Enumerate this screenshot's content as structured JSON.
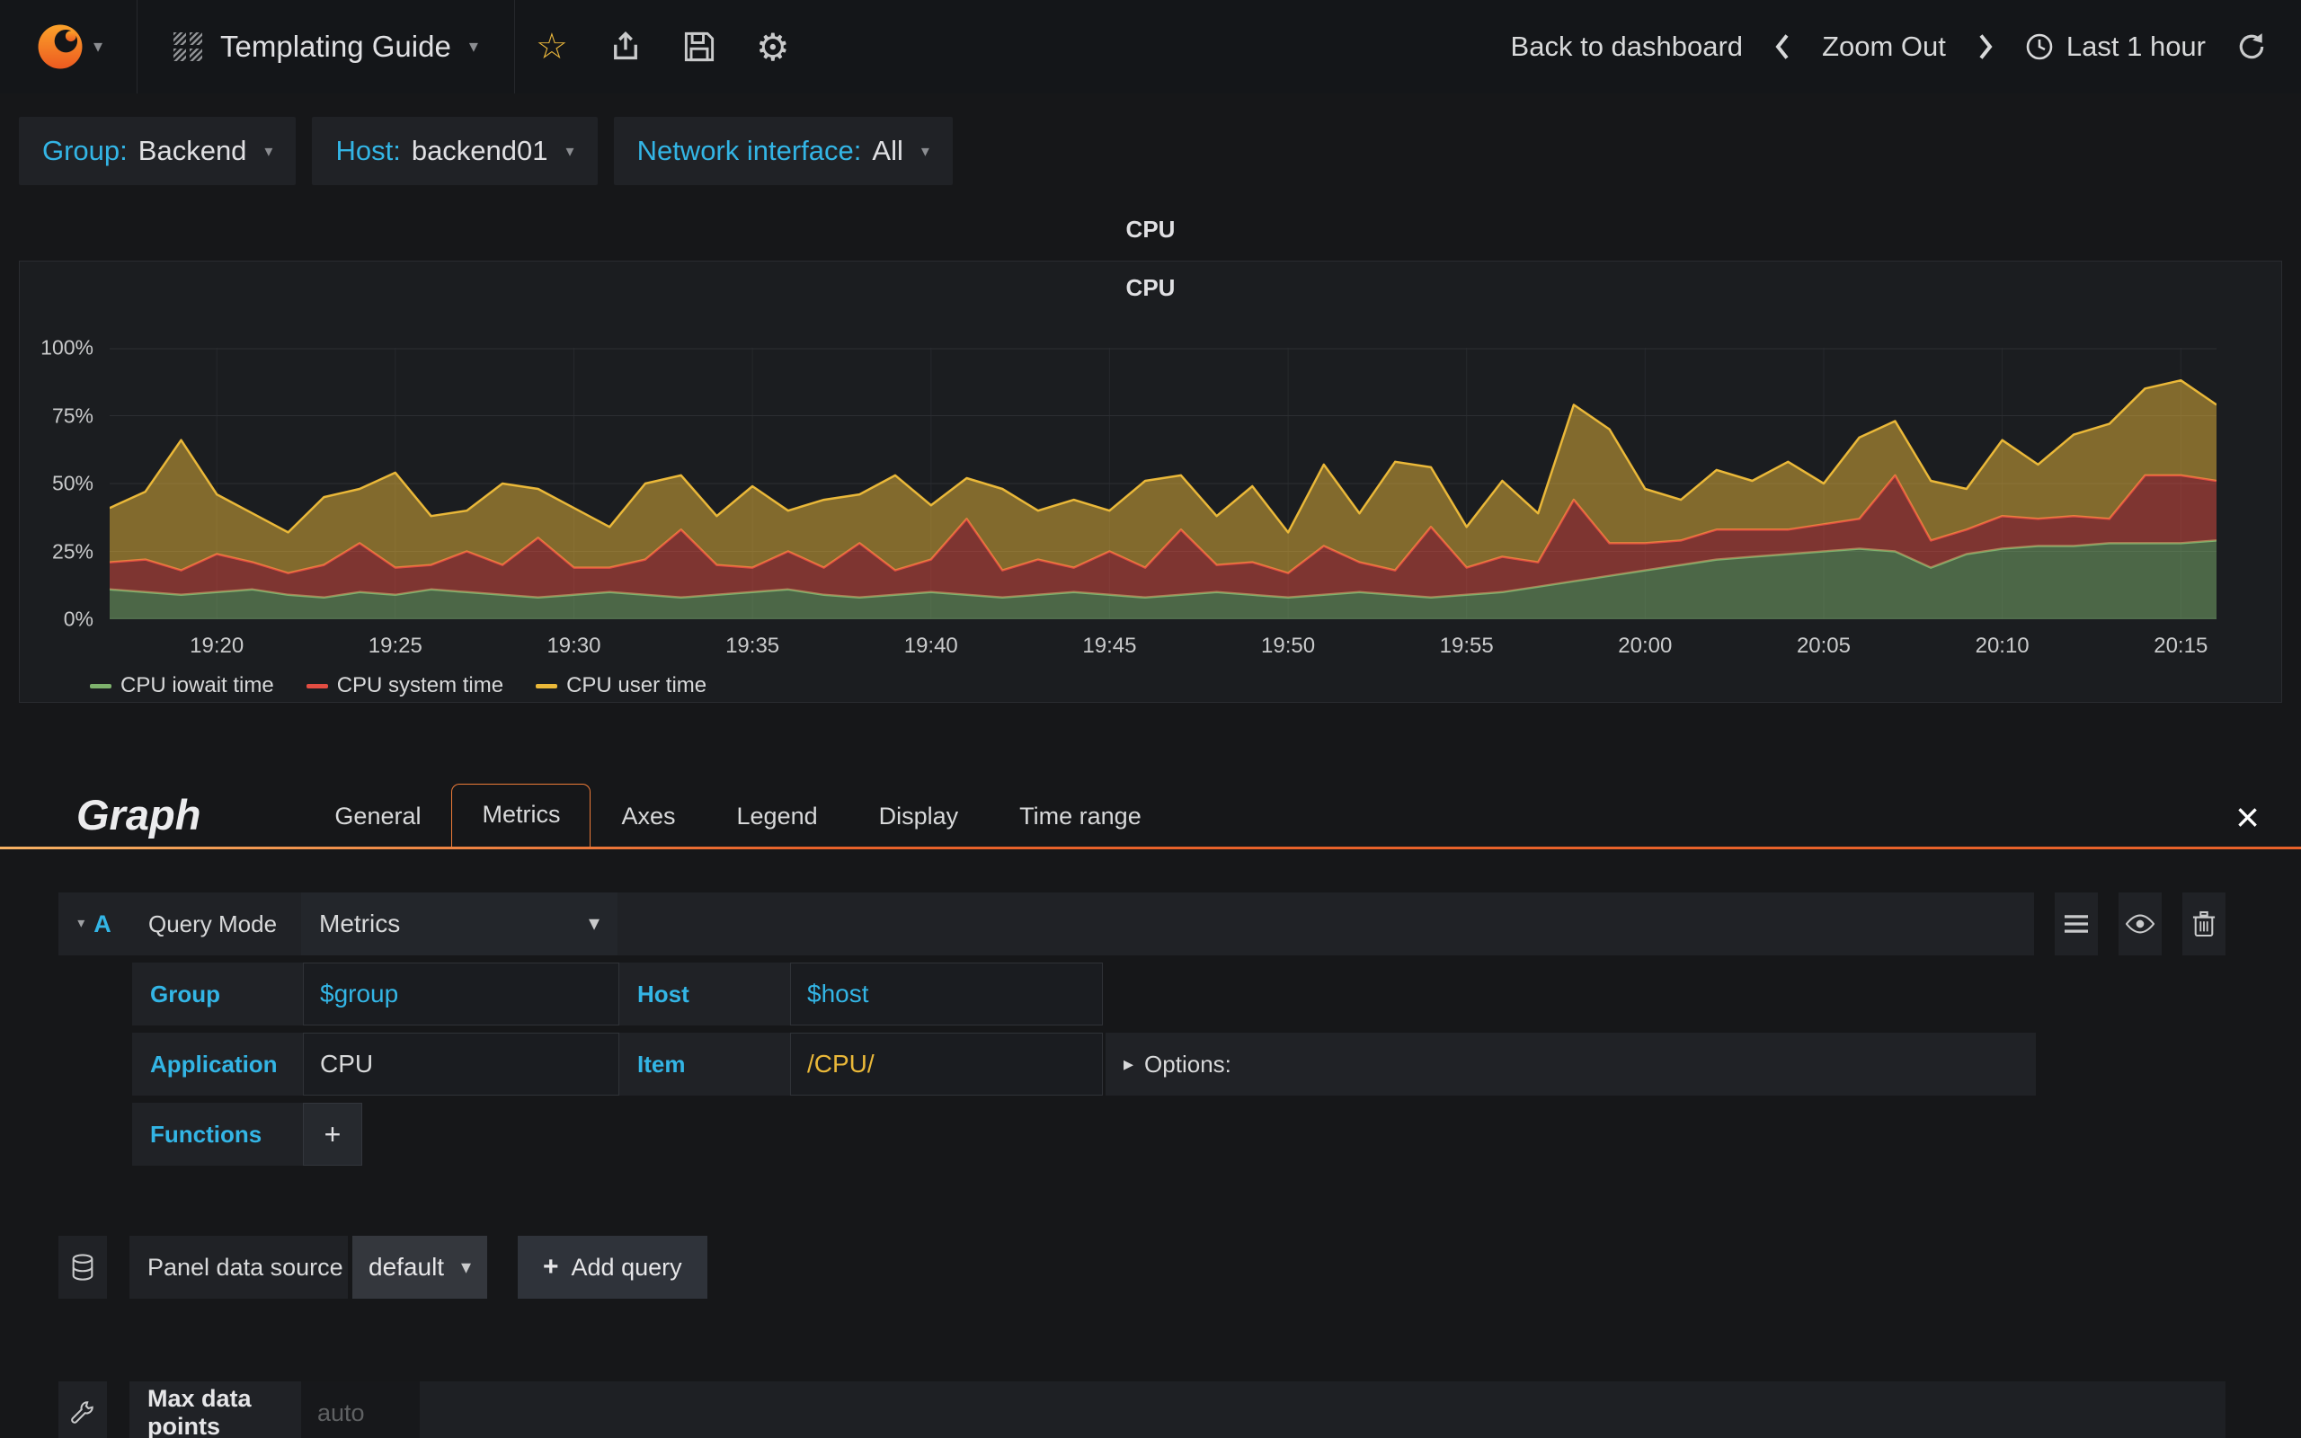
{
  "glyphs": {
    "caret_down": "▾",
    "caret_right": "▸",
    "star": "☆",
    "gear": "⚙",
    "plus": "+",
    "close": "×"
  },
  "colors": {
    "accent_cyan": "#33b5e5",
    "tab_orange": "#ec7b38",
    "green": "#7EB26D",
    "red": "#E24D42",
    "yellow": "#EAB839"
  },
  "navbar": {
    "title": "Templating Guide",
    "back_to_dashboard": "Back to dashboard",
    "zoom_out": "Zoom Out",
    "time_range": "Last 1 hour"
  },
  "template_vars": [
    {
      "label": "Group:",
      "value": "Backend"
    },
    {
      "label": "Host:",
      "value": "backend01"
    },
    {
      "label": "Network interface:",
      "value": "All"
    }
  ],
  "panel": {
    "outer_title": "CPU",
    "title": "CPU"
  },
  "chart_data": {
    "type": "area",
    "stacked": true,
    "title": "CPU",
    "ylim": [
      0,
      100
    ],
    "grid": true,
    "legend_position": "bottom",
    "y_ticks": [
      "0%",
      "25%",
      "50%",
      "75%",
      "100%"
    ],
    "x_ticks": [
      "19:20",
      "19:25",
      "19:30",
      "19:35",
      "19:40",
      "19:45",
      "19:50",
      "19:55",
      "20:00",
      "20:05",
      "20:10",
      "20:15"
    ],
    "tick_start_index": 3,
    "tick_step": 5,
    "x_start": "19:17",
    "x_interval_minutes": 1,
    "series": [
      {
        "name": "CPU iowait time",
        "color": "#7EB26D",
        "values": [
          11,
          10,
          9,
          10,
          11,
          9,
          8,
          10,
          9,
          11,
          10,
          9,
          8,
          9,
          10,
          9,
          8,
          9,
          10,
          11,
          9,
          8,
          9,
          10,
          9,
          8,
          9,
          10,
          9,
          8,
          9,
          10,
          9,
          8,
          9,
          10,
          9,
          8,
          9,
          10,
          12,
          14,
          16,
          18,
          20,
          22,
          23,
          24,
          25,
          26,
          25,
          19,
          24,
          26,
          27,
          27,
          28,
          28,
          28,
          29
        ]
      },
      {
        "name": "CPU system time",
        "color": "#E24D42",
        "values": [
          10,
          12,
          9,
          14,
          10,
          8,
          12,
          18,
          10,
          9,
          15,
          11,
          22,
          10,
          9,
          13,
          25,
          11,
          9,
          14,
          10,
          20,
          9,
          12,
          28,
          10,
          13,
          9,
          16,
          11,
          24,
          10,
          12,
          9,
          18,
          11,
          9,
          26,
          10,
          13,
          9,
          30,
          12,
          10,
          9,
          11,
          10,
          9,
          10,
          11,
          28,
          10,
          9,
          12,
          10,
          11,
          9,
          25,
          25,
          22
        ]
      },
      {
        "name": "CPU user time",
        "color": "#EAB839",
        "values": [
          20,
          25,
          48,
          22,
          18,
          15,
          25,
          20,
          35,
          18,
          15,
          30,
          18,
          22,
          15,
          28,
          20,
          18,
          30,
          15,
          25,
          18,
          35,
          20,
          15,
          30,
          18,
          25,
          15,
          32,
          20,
          18,
          28,
          15,
          30,
          18,
          40,
          22,
          15,
          28,
          18,
          35,
          42,
          20,
          15,
          22,
          18,
          25,
          15,
          30,
          20,
          22,
          15,
          28,
          20,
          30,
          35,
          32,
          35,
          28
        ]
      }
    ]
  },
  "editor": {
    "panel_type": "Graph",
    "tabs": [
      "General",
      "Metrics",
      "Axes",
      "Legend",
      "Display",
      "Time range"
    ],
    "active_tab": "Metrics",
    "query": {
      "ref_letter": "A",
      "mode_label": "Query Mode",
      "mode_value": "Metrics",
      "group_label": "Group",
      "group_value": "$group",
      "host_label": "Host",
      "host_value": "$host",
      "application_label": "Application",
      "application_value": "CPU",
      "item_label": "Item",
      "item_value": "/CPU/",
      "options_label": "Options:",
      "functions_label": "Functions"
    },
    "datasource": {
      "label": "Panel data source",
      "value": "default",
      "add_query_label": "Add query"
    },
    "max_data_points": {
      "label": "Max data points",
      "placeholder": "auto"
    }
  }
}
